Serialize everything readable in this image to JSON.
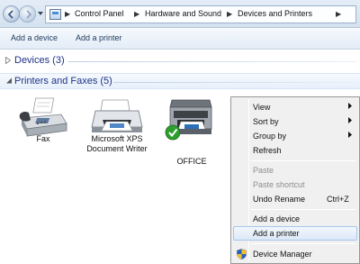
{
  "address_bar": {
    "breadcrumbs": [
      "Control Panel",
      "Hardware and Sound",
      "Devices and Printers"
    ]
  },
  "toolbar": {
    "add_device": "Add a device",
    "add_printer": "Add a printer"
  },
  "groups": {
    "devices": "Devices (3)",
    "printers": "Printers and Faxes (5)"
  },
  "devices": [
    {
      "label": "Fax",
      "icon": "fax-icon"
    },
    {
      "label_line1": "Microsoft XPS",
      "label_line2": "Document Writer",
      "icon": "printer-icon"
    },
    {
      "label": "OFFICE",
      "icon": "multifunction-printer-icon",
      "default": true
    }
  ],
  "context_menu": {
    "view": "View",
    "sort_by": "Sort by",
    "group_by": "Group by",
    "refresh": "Refresh",
    "paste": "Paste",
    "paste_shortcut": "Paste shortcut",
    "undo_rename": "Undo Rename",
    "undo_shortcut": "Ctrl+Z",
    "add_device": "Add a device",
    "add_printer": "Add a printer",
    "device_manager": "Device Manager"
  },
  "colors": {
    "link_blue": "#1e3287",
    "menu_hover": "#dde9f7",
    "default_check": "#2e9e2e"
  }
}
